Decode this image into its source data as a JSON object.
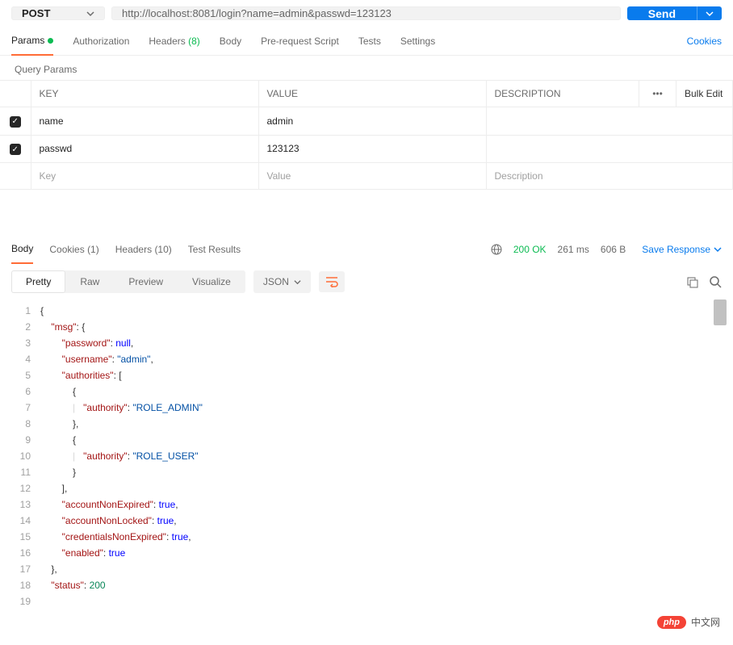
{
  "request": {
    "method": "POST",
    "url": "http://localhost:8081/login?name=admin&passwd=123123",
    "send_label": "Send"
  },
  "tabs": {
    "params": "Params",
    "authorization": "Authorization",
    "headers": "Headers",
    "headers_count": "(8)",
    "body": "Body",
    "prerequest": "Pre-request Script",
    "tests": "Tests",
    "settings": "Settings",
    "cookies": "Cookies"
  },
  "query_params": {
    "section_label": "Query Params",
    "columns": {
      "key": "KEY",
      "value": "VALUE",
      "description": "DESCRIPTION",
      "bulk": "Bulk Edit"
    },
    "rows": [
      {
        "checked": true,
        "key": "name",
        "value": "admin",
        "description": ""
      },
      {
        "checked": true,
        "key": "passwd",
        "value": "123123",
        "description": ""
      }
    ],
    "placeholders": {
      "key": "Key",
      "value": "Value",
      "description": "Description"
    }
  },
  "response_tabs": {
    "body": "Body",
    "cookies": "Cookies",
    "cookies_count": "(1)",
    "headers": "Headers",
    "headers_count": "(10)",
    "test_results": "Test Results"
  },
  "status": {
    "code": "200 OK",
    "time": "261 ms",
    "size": "606 B",
    "save": "Save Response"
  },
  "view": {
    "pretty": "Pretty",
    "raw": "Raw",
    "preview": "Preview",
    "visualize": "Visualize",
    "format": "JSON"
  },
  "response_body": {
    "lines": [
      [
        [
          "brace",
          "{"
        ]
      ],
      [
        [
          "pad",
          "    "
        ],
        [
          "key",
          "\"msg\""
        ],
        [
          "brace",
          ": {"
        ]
      ],
      [
        [
          "pad",
          "        "
        ],
        [
          "key",
          "\"password\""
        ],
        [
          "brace",
          ": "
        ],
        [
          "null",
          "null"
        ],
        [
          "brace",
          ","
        ]
      ],
      [
        [
          "pad",
          "        "
        ],
        [
          "key",
          "\"username\""
        ],
        [
          "brace",
          ": "
        ],
        [
          "str",
          "\"admin\""
        ],
        [
          "brace",
          ","
        ]
      ],
      [
        [
          "pad",
          "        "
        ],
        [
          "key",
          "\"authorities\""
        ],
        [
          "brace",
          ": ["
        ]
      ],
      [
        [
          "pad",
          "            "
        ],
        [
          "brace",
          "{"
        ]
      ],
      [
        [
          "pad",
          "            "
        ],
        [
          "guide",
          "|   "
        ],
        [
          "key",
          "\"authority\""
        ],
        [
          "brace",
          ": "
        ],
        [
          "str",
          "\"ROLE_ADMIN\""
        ]
      ],
      [
        [
          "pad",
          "            "
        ],
        [
          "brace",
          "},"
        ]
      ],
      [
        [
          "pad",
          "            "
        ],
        [
          "brace",
          "{"
        ]
      ],
      [
        [
          "pad",
          "            "
        ],
        [
          "guide",
          "|   "
        ],
        [
          "key",
          "\"authority\""
        ],
        [
          "brace",
          ": "
        ],
        [
          "str",
          "\"ROLE_USER\""
        ]
      ],
      [
        [
          "pad",
          "            "
        ],
        [
          "brace",
          "}"
        ]
      ],
      [
        [
          "pad",
          "        "
        ],
        [
          "brace",
          "],"
        ]
      ],
      [
        [
          "pad",
          "        "
        ],
        [
          "key",
          "\"accountNonExpired\""
        ],
        [
          "brace",
          ": "
        ],
        [
          "bool",
          "true"
        ],
        [
          "brace",
          ","
        ]
      ],
      [
        [
          "pad",
          "        "
        ],
        [
          "key",
          "\"accountNonLocked\""
        ],
        [
          "brace",
          ": "
        ],
        [
          "bool",
          "true"
        ],
        [
          "brace",
          ","
        ]
      ],
      [
        [
          "pad",
          "        "
        ],
        [
          "key",
          "\"credentialsNonExpired\""
        ],
        [
          "brace",
          ": "
        ],
        [
          "bool",
          "true"
        ],
        [
          "brace",
          ","
        ]
      ],
      [
        [
          "pad",
          "        "
        ],
        [
          "key",
          "\"enabled\""
        ],
        [
          "brace",
          ": "
        ],
        [
          "bool",
          "true"
        ]
      ],
      [
        [
          "pad",
          "    "
        ],
        [
          "brace",
          "},"
        ]
      ],
      [
        [
          "pad",
          "    "
        ],
        [
          "key",
          "\"status\""
        ],
        [
          "brace",
          ": "
        ],
        [
          "num",
          "200"
        ]
      ],
      [
        [
          "brace",
          ""
        ]
      ]
    ]
  },
  "watermark": {
    "badge": "php",
    "text": "中文网"
  }
}
